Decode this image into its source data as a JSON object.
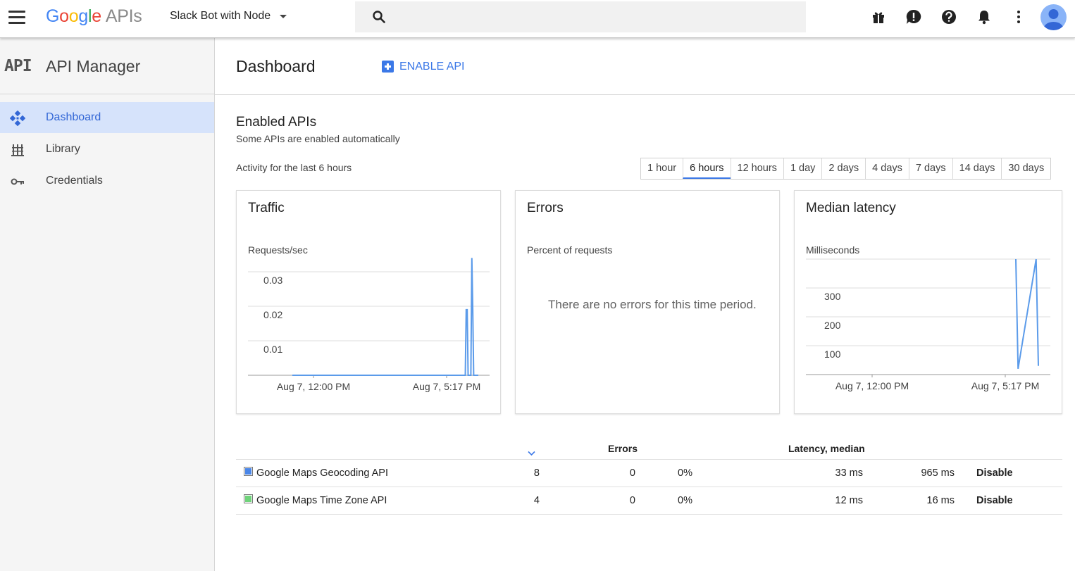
{
  "header": {
    "logo_google": [
      "G",
      "o",
      "o",
      "g",
      "l",
      "e"
    ],
    "logo_apis": "APIs",
    "project": "Slack Bot with Node",
    "search_placeholder": "",
    "icons": [
      "menu-icon",
      "search-icon",
      "gift-icon",
      "feedback-icon",
      "help-icon",
      "notifications-icon",
      "more-vert-icon",
      "account-icon"
    ]
  },
  "sidebar": {
    "glyph": "API",
    "title": "API Manager",
    "items": [
      {
        "label": "Dashboard",
        "icon": "dashboard-icon",
        "active": true
      },
      {
        "label": "Library",
        "icon": "library-icon",
        "active": false
      },
      {
        "label": "Credentials",
        "icon": "key-icon",
        "active": false
      }
    ]
  },
  "main": {
    "title": "Dashboard",
    "enable_label": "ENABLE API",
    "section_title": "Enabled APIs",
    "section_sub": "Some APIs are enabled automatically",
    "activity": "Activity for the last 6 hours",
    "ranges": [
      "1 hour",
      "6 hours",
      "12 hours",
      "1 day",
      "2 days",
      "4 days",
      "7 days",
      "14 days",
      "30 days"
    ],
    "selected_range": "6 hours"
  },
  "colors": {
    "accent": "#3b78e7",
    "series": "#5b9bea",
    "geocoding": "#4a86e8",
    "timezone": "#6fd37a"
  },
  "chart_data": [
    {
      "type": "line",
      "title": "Traffic",
      "ylabel": "Requests/sec",
      "y_ticks": [
        "0.03",
        "0.02",
        "0.01"
      ],
      "x_ticks": [
        "Aug 7, 12:00 PM",
        "Aug 7, 5:17 PM"
      ],
      "series": [
        {
          "x": [
            0,
            0.93,
            0.935,
            0.94,
            0.945,
            0.95,
            0.96,
            0.965,
            0.97,
            0.975,
            0.98,
            1.0
          ],
          "values": [
            0,
            0,
            0.019,
            0.019,
            0,
            0,
            0,
            0.034,
            0.019,
            0,
            0,
            0
          ]
        }
      ]
    },
    {
      "type": "line",
      "title": "Errors",
      "ylabel": "Percent of requests",
      "message": "There are no errors for this time period."
    },
    {
      "type": "line",
      "title": "Median latency",
      "ylabel": "Milliseconds",
      "y_ticks": [
        "300",
        "200",
        "100"
      ],
      "x_ticks": [
        "Aug 7, 12:00 PM",
        "Aug 7, 5:17 PM"
      ],
      "series": [
        {
          "points": [
            [
              0.9,
              400
            ],
            [
              0.91,
              20
            ],
            [
              0.99,
              400
            ],
            [
              1.0,
              30
            ]
          ]
        }
      ]
    }
  ],
  "table": {
    "headers": {
      "errors": "Errors",
      "latency": "Latency, median"
    },
    "rows": [
      {
        "name": "Google Maps Geocoding API",
        "requests": "8",
        "errors": "0",
        "error_pct": "0%",
        "latency_median": "33 ms",
        "latency_98": "965 ms",
        "action": "Disable",
        "swatch": "#4a86e8"
      },
      {
        "name": "Google Maps Time Zone API",
        "requests": "4",
        "errors": "0",
        "error_pct": "0%",
        "latency_median": "12 ms",
        "latency_98": "16 ms",
        "action": "Disable",
        "swatch": "#6fd37a"
      }
    ]
  }
}
